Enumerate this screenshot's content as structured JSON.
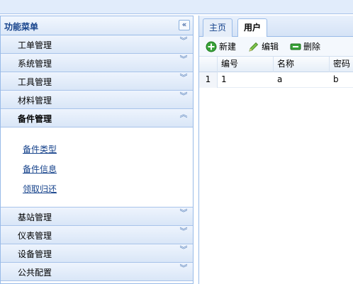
{
  "sidebar": {
    "title": "功能菜单",
    "collapse_glyph": "«",
    "items": [
      {
        "label": "工单管理",
        "open": false
      },
      {
        "label": "系统管理",
        "open": false
      },
      {
        "label": "工具管理",
        "open": false
      },
      {
        "label": "材料管理",
        "open": false
      },
      {
        "label": "备件管理",
        "open": true
      },
      {
        "label": "基站管理",
        "open": false
      },
      {
        "label": "仪表管理",
        "open": false
      },
      {
        "label": "设备管理",
        "open": false
      },
      {
        "label": "公共配置",
        "open": false
      }
    ],
    "open_links": [
      "备件类型",
      "备件信息",
      "领取归还"
    ],
    "chevron_down": "︾",
    "chevron_up": "︽"
  },
  "tabs": [
    {
      "label": "主页",
      "active": false
    },
    {
      "label": "用户",
      "active": true
    }
  ],
  "toolbar": {
    "new_label": "新建",
    "edit_label": "编辑",
    "delete_label": "删除"
  },
  "grid": {
    "columns": [
      "编号",
      "名称",
      "密码"
    ],
    "rows": [
      {
        "rownum": "1",
        "cells": [
          "1",
          "a",
          "b"
        ]
      }
    ]
  },
  "colors": {
    "accent": "#15428b",
    "border": "#99bbe8",
    "header_bg": "#dce8f8"
  }
}
